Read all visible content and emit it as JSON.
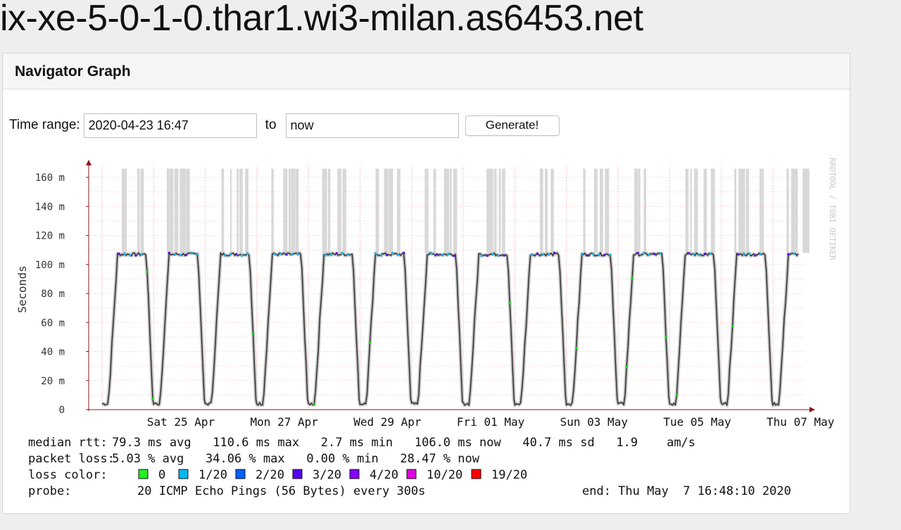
{
  "page": {
    "title": "ix-xe-5-0-1-0.thar1.wi3-milan.as6453.net"
  },
  "panel": {
    "header": "Navigator Graph"
  },
  "controls": {
    "time_range_label": "Time range:",
    "from_value": "2020-04-23 16:47",
    "to_label": "to",
    "to_value": "now",
    "generate_label": "Generate!"
  },
  "graph": {
    "ylabel": "Seconds",
    "watermark": "RRDTOOL / TOBI OETIKER",
    "y_ticks": [
      "0",
      "20 m",
      "40 m",
      "60 m",
      "80 m",
      "100 m",
      "120 m",
      "140 m",
      "160 m"
    ],
    "x_ticks": [
      "Sat 25 Apr",
      "Mon 27 Apr",
      "Wed 29 Apr",
      "Fri 01 May",
      "Sun 03 May",
      "Tue 05 May",
      "Thu 07 May"
    ],
    "colors": {
      "grid": "#f0a0a0",
      "axis": "#8b1a1a",
      "median": "#222222",
      "smoke": "#aaaaaa",
      "loss_0": "#00ee00",
      "loss_1": "#00b8f0",
      "loss_2": "#0060ff",
      "loss_3": "#5500ee",
      "loss_4": "#8800ff",
      "loss_10": "#e000e0",
      "loss_19": "#ff0000"
    },
    "legend": {
      "median_label": "median rtt:",
      "median_values": "79.3 ms avg   110.6 ms max   2.7 ms min   106.0 ms now   40.7 ms sd   1.9    am/s",
      "loss_label": "packet loss:",
      "loss_values": "5.03 % avg   34.06 % max   0.00 % min   28.47 % now",
      "color_label": "loss color:",
      "color_items": [
        {
          "label": "0",
          "color": "#22ee22"
        },
        {
          "label": "1/20",
          "color": "#00b8f0"
        },
        {
          "label": "2/20",
          "color": "#0060ff"
        },
        {
          "label": "3/20",
          "color": "#5500ee"
        },
        {
          "label": "4/20",
          "color": "#8800ff"
        },
        {
          "label": "10/20",
          "color": "#e000e0"
        },
        {
          "label": "19/20",
          "color": "#ff0000"
        }
      ],
      "probe_label": "probe:",
      "probe_value": "20 ICMP Echo Pings (56 Bytes) every 300s",
      "end_value": "end: Thu May  7 16:48:10 2020"
    }
  },
  "chart_data": {
    "type": "line",
    "ylabel": "Seconds",
    "ylim": [
      0,
      0.17
    ],
    "x_range": [
      "2020-04-23 16:47",
      "2020-05-07 16:48"
    ],
    "grid": true,
    "pattern": "daily cycle: ~0.003 s overnight, ~0.107 s during daytime plateau",
    "x_ticks": [
      "Sat 25 Apr",
      "Mon 27 Apr",
      "Wed 29 Apr",
      "Fri 01 May",
      "Sun 03 May",
      "Tue 05 May",
      "Thu 07 May"
    ],
    "series": [
      {
        "name": "median rtt",
        "low": 0.003,
        "high": 0.107,
        "max": 0.1106,
        "min": 0.0027,
        "avg": 0.0793,
        "now": 0.106
      }
    ]
  }
}
